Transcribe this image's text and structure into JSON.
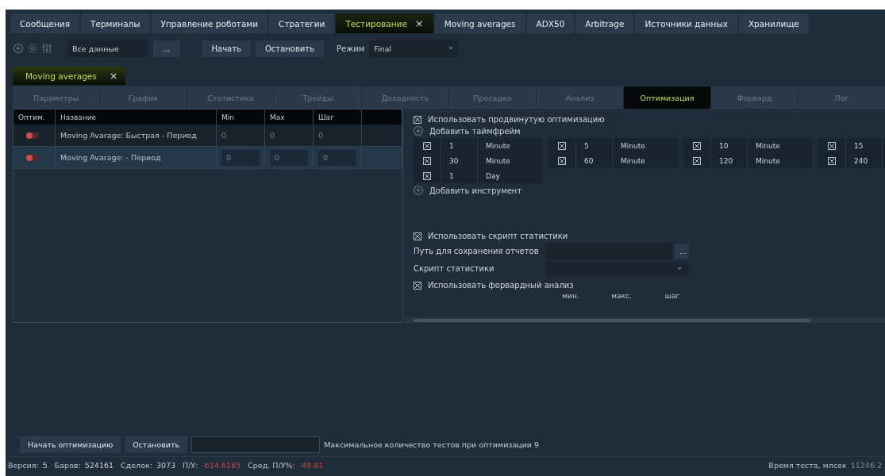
{
  "main_tabs": [
    {
      "label": "Сообщения",
      "selected": false
    },
    {
      "label": "Терминалы",
      "selected": false
    },
    {
      "label": "Управление роботами",
      "selected": false
    },
    {
      "label": "Стратегии",
      "selected": false
    },
    {
      "label": "Тестирование",
      "selected": true,
      "close": "×"
    },
    {
      "label": "Moving averages",
      "selected": false
    },
    {
      "label": "ADX50",
      "selected": false
    },
    {
      "label": "Arbitrage",
      "selected": false
    },
    {
      "label": "Источники данных",
      "selected": false
    },
    {
      "label": "Хранилище",
      "selected": false
    }
  ],
  "toolbar": {
    "source": "Все данные",
    "browse": "...",
    "start": "Начать",
    "stop": "Остановить",
    "mode_label": "Режим",
    "mode": "Final"
  },
  "document_tab": {
    "label": "Moving averages",
    "close": "×",
    "selected": true
  },
  "sub_tabs": [
    {
      "label": "Параметры",
      "selected": false
    },
    {
      "label": "График",
      "selected": false
    },
    {
      "label": "Статистика",
      "selected": false
    },
    {
      "label": "Трейды",
      "selected": false
    },
    {
      "label": "Доходность",
      "selected": false
    },
    {
      "label": "Просадка",
      "selected": false
    },
    {
      "label": "Анализ",
      "selected": false
    },
    {
      "label": "Оптимизация",
      "selected": true
    },
    {
      "label": "Форвард",
      "selected": false
    },
    {
      "label": "Лог",
      "selected": false
    }
  ],
  "params_table": {
    "columns": [
      "Оптим.",
      "Название",
      "Min",
      "Max",
      "Шаг"
    ],
    "rows": [
      {
        "on": false,
        "name": "Moving Avarage: Быстрая - Период",
        "min": "0",
        "max": "0",
        "step": "0",
        "selected": false
      },
      {
        "on": false,
        "name": "Moving Avarage:  - Период",
        "min": "0",
        "max": "0",
        "step": "0",
        "selected": true
      }
    ]
  },
  "optimization": {
    "advanced": {
      "label": "Использовать продвинутую оптимизацию",
      "checked": true
    },
    "add_timeframe": "Добавить таймфрейм",
    "timeframe_groups": [
      {
        "rows": [
          {
            "checked": true,
            "value": "1",
            "unit": "Minute"
          },
          {
            "checked": true,
            "value": "30",
            "unit": "Minute"
          },
          {
            "checked": true,
            "value": "1",
            "unit": "Day"
          }
        ]
      },
      {
        "rows": [
          {
            "checked": true,
            "value": "5",
            "unit": "Minute"
          },
          {
            "checked": true,
            "value": "60",
            "unit": "Minute"
          }
        ]
      },
      {
        "rows": [
          {
            "checked": true,
            "value": "10",
            "unit": "Minute"
          },
          {
            "checked": true,
            "value": "120",
            "unit": "Minute"
          }
        ]
      },
      {
        "rows": [
          {
            "checked": true,
            "value": "15"
          },
          {
            "checked": true,
            "value": "240"
          }
        ]
      }
    ],
    "add_instrument": "Добавить инструмент",
    "stats_script": {
      "label": "Использовать скрипт статистики",
      "checked": true
    },
    "report_path_label": "Путь для сохранения отчетов",
    "report_path_browse": "...",
    "script_label": "Скрипт статистики",
    "forward": {
      "label": "Использовать форвардный анализ",
      "checked": true
    },
    "range_headers": [
      "мин.",
      "макс.",
      "шаг"
    ]
  },
  "bottom": {
    "start": "Начать оптимизацию",
    "stop": "Остановить",
    "progress": {
      "level": 0
    },
    "max_tests": "Максимальное количество тестов при оптимизации 9"
  },
  "status_bar": {
    "items": [
      {
        "label": "Версия:",
        "value": "5",
        "negative": false
      },
      {
        "label": "Баров:",
        "value": "524161",
        "negative": false
      },
      {
        "label": "Сделок:",
        "value": "3073",
        "negative": false
      },
      {
        "label": "П/У:",
        "value": "-614.6185",
        "negative": true
      },
      {
        "label": "Сред. П/У%:",
        "value": "-49.81",
        "negative": true
      }
    ],
    "time_label": "Время теста, млсек",
    "time_value": "11246.2"
  }
}
